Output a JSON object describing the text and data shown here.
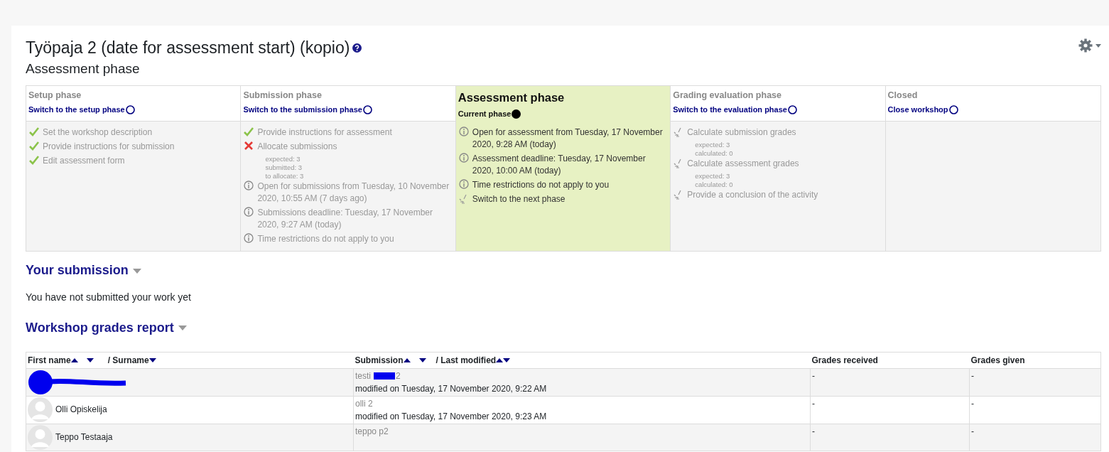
{
  "title": "Työpaja 2 (date for assessment start) (kopio)",
  "phase_heading": "Assessment phase",
  "phases": [
    {
      "title": "Setup phase",
      "selected": false,
      "action": "Switch to the setup phase",
      "tasks": [
        {
          "kind": "done",
          "text": "Set the workshop description"
        },
        {
          "kind": "done",
          "text": "Provide instructions for submission"
        },
        {
          "kind": "done",
          "text": "Edit assessment form"
        }
      ]
    },
    {
      "title": "Submission phase",
      "selected": false,
      "action": "Switch to the submission phase",
      "tasks": [
        {
          "kind": "done",
          "text": "Provide instructions for assessment"
        },
        {
          "kind": "fail",
          "text": "Allocate submissions",
          "details": [
            "expected: 3",
            "submitted: 3",
            "to allocate: 3"
          ]
        },
        {
          "kind": "info",
          "text": "Open for submissions from Tuesday, 10 November 2020, 10:55 AM (7 days ago)"
        },
        {
          "kind": "info",
          "text": "Submissions deadline: Tuesday, 17 November 2020, 9:27 AM (today)"
        },
        {
          "kind": "info",
          "text": "Time restrictions do not apply to you"
        }
      ]
    },
    {
      "title": "Assessment phase",
      "selected": true,
      "action": "Current phase",
      "tasks": [
        {
          "kind": "info",
          "text": "Open for assessment from Tuesday, 17 November 2020, 9:28 AM (today)"
        },
        {
          "kind": "info",
          "text": "Assessment deadline: Tuesday, 17 November 2020, 10:00 AM (today)"
        },
        {
          "kind": "info",
          "text": "Time restrictions do not apply to you"
        },
        {
          "kind": "todo",
          "text": "Switch to the next phase"
        }
      ]
    },
    {
      "title": "Grading evaluation phase",
      "selected": false,
      "action": "Switch to the evaluation phase",
      "tasks": [
        {
          "kind": "todo",
          "text": "Calculate submission grades",
          "details": [
            "expected: 3",
            "calculated: 0"
          ]
        },
        {
          "kind": "todo",
          "text": "Calculate assessment grades",
          "details": [
            "expected: 3",
            "calculated: 0"
          ]
        },
        {
          "kind": "todo",
          "text": "Provide a conclusion of the activity"
        }
      ]
    },
    {
      "title": "Closed",
      "selected": false,
      "action": "Close workshop"
    }
  ],
  "submission_section": {
    "heading": "Your submission",
    "text": "You have not submitted your work yet"
  },
  "report": {
    "heading": "Workshop grades report",
    "columns": [
      "First name",
      "/ Surname",
      "Submission",
      "/ Last modified",
      "Grades received",
      "Grades given"
    ],
    "rows": [
      {
        "redacted": true,
        "submission": [
          "testi",
          "2"
        ],
        "modified": "modified on Tuesday, 17 November 2020, 9:22 AM",
        "grades_received": "-",
        "grades_given": "-"
      },
      {
        "redacted": false,
        "name": "Olli Opiskelija",
        "submission": [
          "olli 2"
        ],
        "modified": "modified on Tuesday, 17 November 2020, 9:23 AM",
        "grades_received": "-",
        "grades_given": "-"
      },
      {
        "redacted": false,
        "name": "Teppo Testaaja",
        "submission": [
          "teppo p2"
        ],
        "grades_received": "-",
        "grades_given": "-"
      }
    ]
  }
}
